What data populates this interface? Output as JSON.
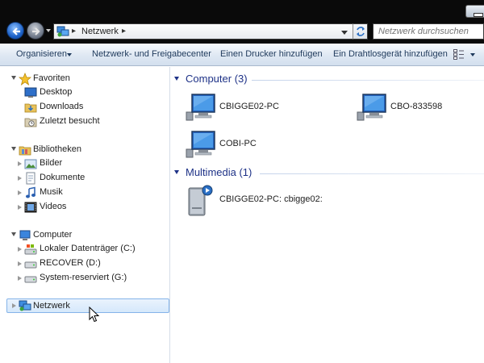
{
  "window": {
    "address": {
      "segment": "Netzwerk"
    },
    "search": {
      "placeholder": "Netzwerk durchsuchen"
    }
  },
  "toolbar": {
    "organize": "Organisieren",
    "sharing_center": "Netzwerk- und Freigabecenter",
    "add_printer": "Einen Drucker hinzufügen",
    "add_wireless": "Ein Drahtlosgerät hinzufügen"
  },
  "nav": {
    "favorites": {
      "label": "Favoriten",
      "items": [
        {
          "label": "Desktop",
          "icon": "desktop-icon"
        },
        {
          "label": "Downloads",
          "icon": "downloads-folder-icon"
        },
        {
          "label": "Zuletzt besucht",
          "icon": "recent-places-icon"
        }
      ]
    },
    "libraries": {
      "label": "Bibliotheken",
      "items": [
        {
          "label": "Bilder",
          "icon": "pictures-library-icon"
        },
        {
          "label": "Dokumente",
          "icon": "documents-library-icon"
        },
        {
          "label": "Musik",
          "icon": "music-library-icon"
        },
        {
          "label": "Videos",
          "icon": "videos-library-icon"
        }
      ]
    },
    "computer": {
      "label": "Computer",
      "items": [
        {
          "label": "Lokaler Datenträger (C:)",
          "icon": "local-disk-icon"
        },
        {
          "label": "RECOVER (D:)",
          "icon": "drive-icon"
        },
        {
          "label": "System-reserviert (G:)",
          "icon": "drive-icon"
        }
      ]
    },
    "network": {
      "label": "Netzwerk",
      "selected": true
    }
  },
  "content": {
    "groups": [
      {
        "title": "Computer (3)",
        "items": [
          {
            "label": "CBIGGE02-PC",
            "icon": "computer-icon"
          },
          {
            "label": "CBO-833598",
            "icon": "computer-icon"
          },
          {
            "label": "COBI-PC",
            "icon": "computer-icon"
          }
        ]
      },
      {
        "title": "Multimedia (1)",
        "items": [
          {
            "label": "CBIGGE02-PC: cbigge02:",
            "icon": "media-server-icon"
          }
        ]
      }
    ]
  },
  "colors": {
    "frame": "#0a0a0a",
    "toolbar_text": "#1e395b",
    "group_header": "#1e3287",
    "selection_border": "#85b4e9"
  }
}
